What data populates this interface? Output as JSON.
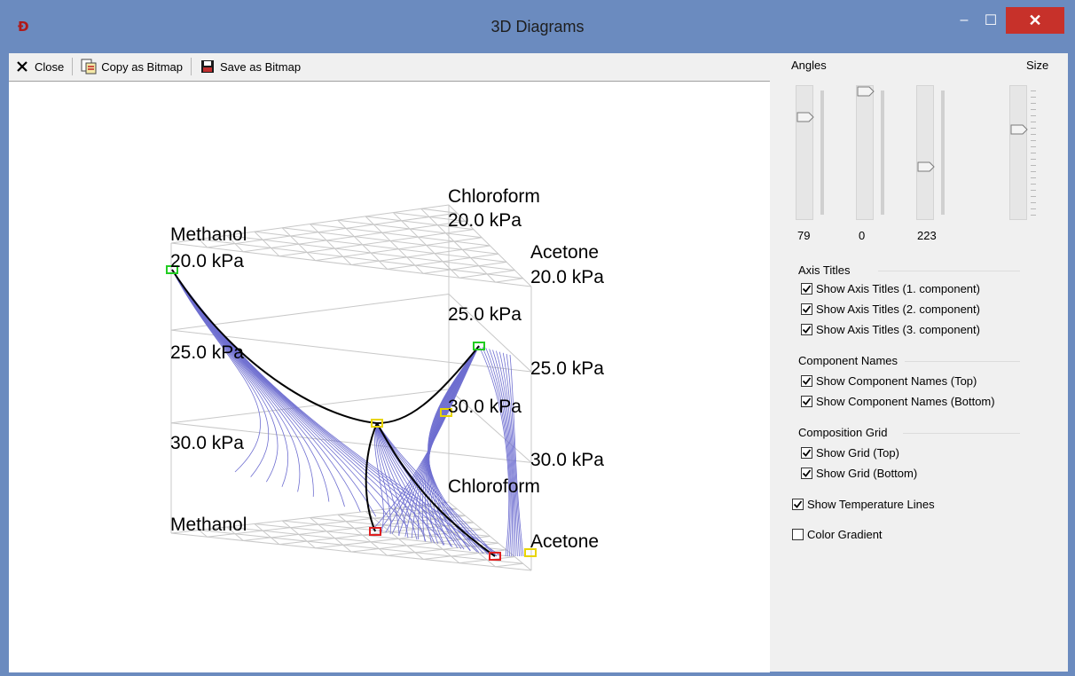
{
  "window": {
    "title": "3D Diagrams",
    "minimize_glyph": "–",
    "maximize_glyph": "☐",
    "close_glyph": "✕"
  },
  "toolbar": {
    "close_label": "Close",
    "copy_label": "Copy as Bitmap",
    "save_label": "Save as Bitmap",
    "close_icon": "x-icon",
    "copy_icon": "copy-bitmap-icon",
    "save_icon": "floppy-disk-icon"
  },
  "diagram": {
    "top_labels": {
      "methanol": "Methanol",
      "chloroform": "Chloroform",
      "acetone": "Acetone"
    },
    "bottom_labels": {
      "methanol": "Methanol",
      "chloroform": "Chloroform",
      "acetone": "Acetone"
    },
    "axis_labels": {
      "left_20": "20.0 kPa",
      "left_25": "25.0 kPa",
      "left_30": "30.0 kPa",
      "back_20": "20.0 kPa",
      "back_25": "25.0 kPa",
      "back_30": "30.0 kPa",
      "right_20": "20.0 kPa",
      "right_25": "25.0 kPa",
      "right_30": "30.0 kPa"
    },
    "colors": {
      "curves": "#6e6ed0",
      "heavy": "#000000",
      "grid": "#c8c8c8",
      "marker_green": "#22cc22",
      "marker_yellow": "#e8d400",
      "marker_red": "#e02020"
    }
  },
  "panel": {
    "angles_label": "Angles",
    "size_label": "Size",
    "angle_values": [
      "79",
      "0",
      "223"
    ],
    "axis_titles": {
      "header": "Axis Titles",
      "items": [
        {
          "label": "Show Axis Titles (1. component)",
          "checked": true
        },
        {
          "label": "Show Axis Titles (2. component)",
          "checked": true
        },
        {
          "label": "Show Axis Titles (3. component)",
          "checked": true
        }
      ]
    },
    "component_names": {
      "header": "Component Names",
      "items": [
        {
          "label": "Show Component Names (Top)",
          "checked": true
        },
        {
          "label": "Show Component Names (Bottom)",
          "checked": true
        }
      ]
    },
    "composition_grid": {
      "header": "Composition Grid",
      "items": [
        {
          "label": "Show Grid (Top)",
          "checked": true
        },
        {
          "label": "Show Grid (Bottom)",
          "checked": true
        }
      ]
    },
    "show_temperature_lines": {
      "label": "Show Temperature Lines",
      "checked": true
    },
    "color_gradient": {
      "label": "Color Gradient",
      "checked": false
    }
  }
}
